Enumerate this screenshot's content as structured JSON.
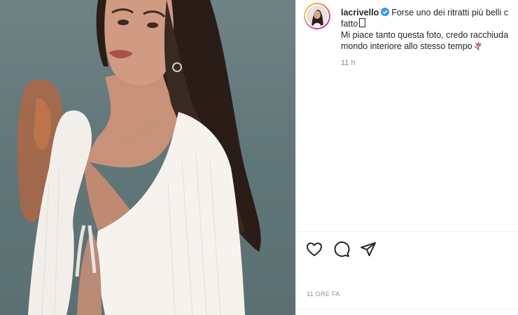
{
  "post": {
    "username": "lacrivello",
    "caption_line1": "Forse uno dei ritratti più belli c",
    "caption_line2": "fatto",
    "caption_line3": "Mi piace tanto questa foto, credo racchiuda",
    "caption_line4": "mondo interiore allo stesso tempo",
    "caption_time": "11 h",
    "post_time": "11 ORE FA",
    "verified": true
  },
  "icons": {
    "like": "heart-icon",
    "comment": "comment-icon",
    "share": "paper-plane-icon",
    "verified": "verified-badge-icon",
    "emoji": "tulip-icon"
  },
  "colors": {
    "text": "#262626",
    "muted": "#8e8e8e",
    "verified": "#3897f0",
    "divider": "#efefef"
  }
}
